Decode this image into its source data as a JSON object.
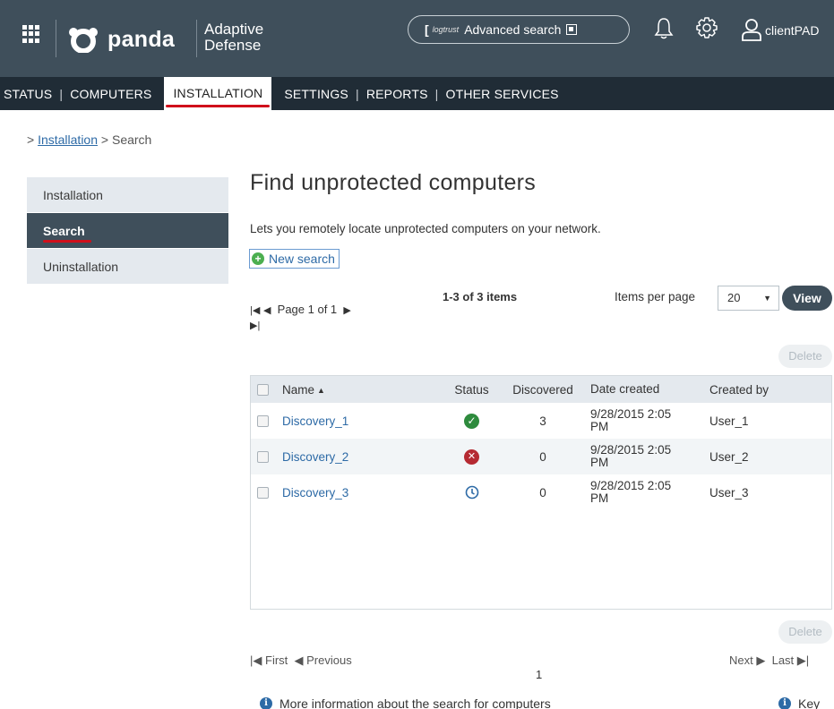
{
  "header": {
    "brand": "panda",
    "product_line1": "Adaptive",
    "product_line2": "Defense",
    "search_brand": "logtrust",
    "search_label": "Advanced search",
    "user_name": "clientPAD"
  },
  "nav": {
    "items": [
      "STATUS",
      "COMPUTERS",
      "INSTALLATION",
      "SETTINGS",
      "REPORTS",
      "OTHER SERVICES"
    ],
    "active": "INSTALLATION",
    "separator": "|"
  },
  "breadcrumb": {
    "prefix": ">",
    "link": "Installation",
    "separator": ">",
    "current": "Search"
  },
  "sidebar": {
    "items": [
      {
        "label": "Installation"
      },
      {
        "label": "Search"
      },
      {
        "label": "Uninstallation"
      }
    ],
    "active": "Search"
  },
  "main": {
    "title": "Find unprotected computers",
    "description": "Lets you remotely locate unprotected computers on your network.",
    "new_search_label": "New search"
  },
  "pager_top": {
    "page_text": "Page 1 of 1",
    "items_count": "1-3 of 3 items",
    "items_per_page_label": "Items per page",
    "items_per_page_value": "20",
    "view_label": "View"
  },
  "delete_label": "Delete",
  "table": {
    "headers": {
      "name": "Name",
      "status": "Status",
      "discovered": "Discovered",
      "date": "Date created",
      "created_by": "Created by"
    },
    "rows": [
      {
        "name": "Discovery_1",
        "status": "success",
        "discovered": "3",
        "date_line1": "9/28/2015 2:05",
        "date_line2": "PM",
        "created_by": "User_1"
      },
      {
        "name": "Discovery_2",
        "status": "error",
        "discovered": "0",
        "date_line1": "9/28/2015 2:05",
        "date_line2": "PM",
        "created_by": "User_2"
      },
      {
        "name": "Discovery_3",
        "status": "pending",
        "discovered": "0",
        "date_line1": "9/28/2015 2:05",
        "date_line2": "PM",
        "created_by": "User_3"
      }
    ]
  },
  "pager_bottom": {
    "first": "First",
    "previous": "Previous",
    "page": "1",
    "next": "Next",
    "last": "Last"
  },
  "footer": {
    "more_info": "More information about the search for computers",
    "key": "Key"
  },
  "colors": {
    "header_bg": "#3f4f5b",
    "nav_bg": "#202c36",
    "accent_red": "#d0101b",
    "link_blue": "#2d6aa6",
    "status_ok": "#2e8b3d",
    "status_error": "#b52a32"
  },
  "icons": [
    "apps-grid-icon",
    "panda-logo-icon",
    "external-link-icon",
    "bell-icon",
    "gear-icon",
    "user-icon",
    "plus-icon",
    "first-page-icon",
    "previous-page-icon",
    "next-page-icon",
    "last-page-icon",
    "sort-asc-icon",
    "check-circle-icon",
    "error-circle-icon",
    "clock-icon",
    "info-icon"
  ]
}
